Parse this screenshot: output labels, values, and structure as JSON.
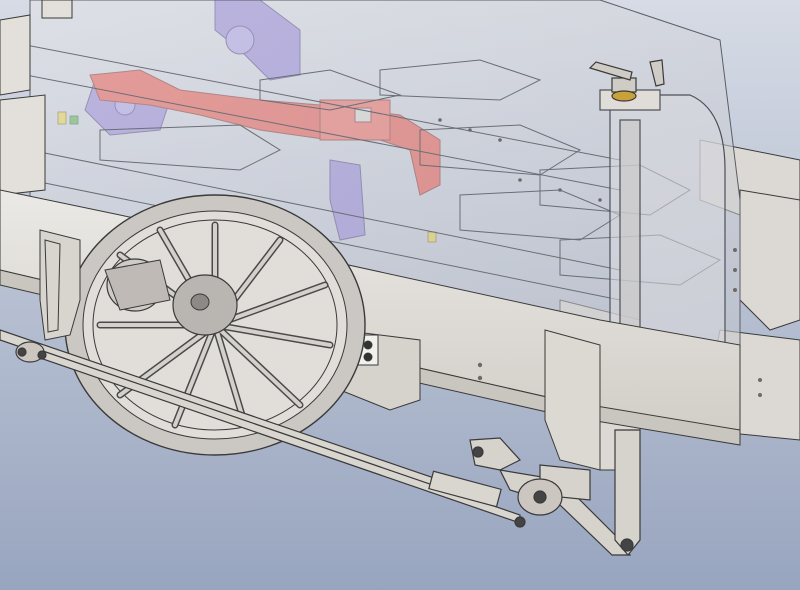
{
  "scene": {
    "subject": "cad-render-locomotive-chassis",
    "colors": {
      "background_top": "#d4d9e4",
      "background_bottom": "#9aa7c0",
      "frame": "#e2e0dc",
      "frame_shade": "#cfcbc6",
      "edge": "#3a3a3a",
      "transparent_body": "#cdd0d6",
      "wheel": "#c8c4c0",
      "wheel_dark": "#8d8a86",
      "red_part": "#e8483d",
      "purple_part": "#8878d8",
      "yellow_part": "#e6d23a",
      "green_part": "#4caa48"
    }
  }
}
